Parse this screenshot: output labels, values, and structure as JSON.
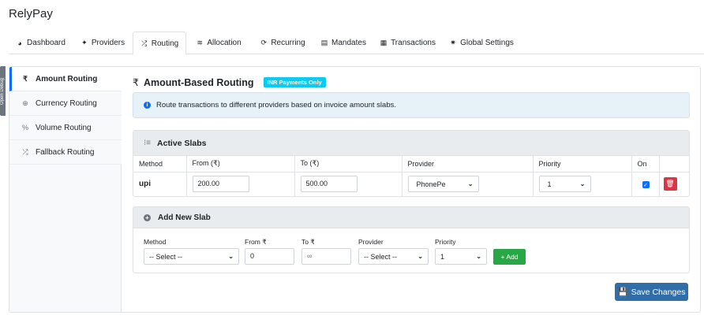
{
  "app": {
    "title": "RelyPay"
  },
  "tabs": [
    {
      "icon": "dashboard-icon",
      "glyph": "◕",
      "label": "Dashboard"
    },
    {
      "icon": "providers-icon",
      "glyph": "✦",
      "label": "Providers"
    },
    {
      "icon": "routing-icon",
      "glyph": "⤮",
      "label": "Routing"
    },
    {
      "icon": "allocation-icon",
      "glyph": "≋",
      "label": "Allocation"
    },
    {
      "icon": "recurring-icon",
      "glyph": "⟳",
      "label": "Recurring"
    },
    {
      "icon": "mandates-icon",
      "glyph": "▤",
      "label": "Mandates"
    },
    {
      "icon": "transactions-icon",
      "glyph": "▦",
      "label": "Transactions"
    },
    {
      "icon": "global-settings-icon",
      "glyph": "✷",
      "label": "Global Settings"
    }
  ],
  "active_tab": "Routing",
  "side_handle": {
    "label": "Open Debug"
  },
  "sidebar": {
    "items": [
      {
        "icon": "rupee-icon",
        "glyph": "₹",
        "label": "Amount Routing",
        "active": true
      },
      {
        "icon": "globe-icon",
        "glyph": "⊕",
        "label": "Currency Routing",
        "active": false
      },
      {
        "icon": "percent-icon",
        "glyph": "%",
        "label": "Volume Routing",
        "active": false
      },
      {
        "icon": "shuffle-icon",
        "glyph": "⤮",
        "label": "Fallback Routing",
        "active": false
      }
    ]
  },
  "main": {
    "title_glyph": "₹",
    "title": "Amount-Based Routing",
    "badge": "INR Payments Only",
    "info_text": "Route transactions to different providers based on invoice amount slabs."
  },
  "slabs": {
    "title": "Active Slabs",
    "columns": [
      "Method",
      "From (₹)",
      "To (₹)",
      "Provider",
      "Priority",
      "On"
    ],
    "rows": [
      {
        "method": "upi",
        "from": "200.00",
        "to": "500.00",
        "provider": "PhonePe",
        "priority": "1",
        "on": true
      }
    ]
  },
  "add_slab": {
    "title": "Add New Slab",
    "method_label": "Method",
    "method_value": "-- Select --",
    "from_label": "From ₹",
    "from_value": "0",
    "to_label": "To ₹",
    "to_placeholder": "∞",
    "provider_label": "Provider",
    "provider_value": "-- Select --",
    "priority_label": "Priority",
    "priority_value": "1",
    "add_button": "+ Add"
  },
  "save_button": "Save Changes",
  "colors": {
    "primary": "#0d6efd",
    "success": "#28a745",
    "danger": "#dc3545",
    "info": "#0dcaf0",
    "save": "#2f6ea8"
  }
}
